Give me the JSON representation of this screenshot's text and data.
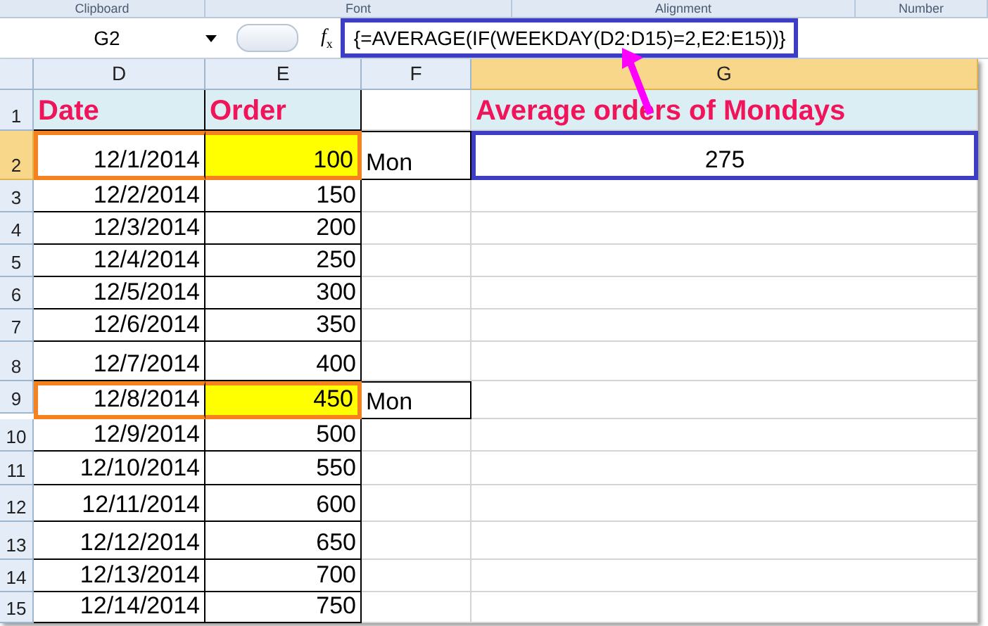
{
  "ribbon_groups": [
    "Clipboard",
    "Font",
    "Alignment",
    "Number"
  ],
  "name_box": "G2",
  "function_symbol": "*f*$_{x}$",
  "formula": "{=AVERAGE(IF(WEEKDAY(D2:D15)=2,E2:E15))}",
  "columns": [
    {
      "label": "D",
      "selected": false
    },
    {
      "label": "E",
      "selected": false
    },
    {
      "label": "F",
      "selected": false
    },
    {
      "label": "G",
      "selected": true
    }
  ],
  "headings": {
    "date": "Date",
    "order": "Order",
    "result": "Average orders of Mondays"
  },
  "rows": [
    {
      "number": "1",
      "selected": false
    },
    {
      "number": "2",
      "selected": true,
      "date": "12/1/2014",
      "order": "100",
      "marked": true,
      "weekday": "Mon",
      "result": "275"
    },
    {
      "number": "3",
      "selected": false,
      "date": "12/2/2014",
      "order": "150",
      "marked": false
    },
    {
      "number": "4",
      "selected": false,
      "date": "12/3/2014",
      "order": "200",
      "marked": false
    },
    {
      "number": "5",
      "selected": false,
      "date": "12/4/2014",
      "order": "250",
      "marked": false
    },
    {
      "number": "6",
      "selected": false,
      "date": "12/5/2014",
      "order": "300",
      "marked": false
    },
    {
      "number": "7",
      "selected": false,
      "date": "12/6/2014",
      "order": "350",
      "marked": false
    },
    {
      "number": "8",
      "selected": false,
      "date": "12/7/2014",
      "order": "400",
      "marked": false
    },
    {
      "number": "9",
      "selected": false,
      "date": "12/8/2014",
      "order": "450",
      "marked": true,
      "weekday": "Mon"
    },
    {
      "number": "10",
      "selected": false,
      "date": "12/9/2014",
      "order": "500",
      "marked": false
    },
    {
      "number": "11",
      "selected": false,
      "date": "12/10/2014",
      "order": "550",
      "marked": false
    },
    {
      "number": "12",
      "selected": false,
      "date": "12/11/2014",
      "order": "600",
      "marked": false
    },
    {
      "number": "13",
      "selected": false,
      "date": "12/12/2014",
      "order": "650",
      "marked": false
    },
    {
      "number": "14",
      "selected": false,
      "date": "12/13/2014",
      "order": "700",
      "marked": false
    },
    {
      "number": "15",
      "selected": false,
      "date": "12/14/2014",
      "order": "750",
      "marked": false
    }
  ]
}
